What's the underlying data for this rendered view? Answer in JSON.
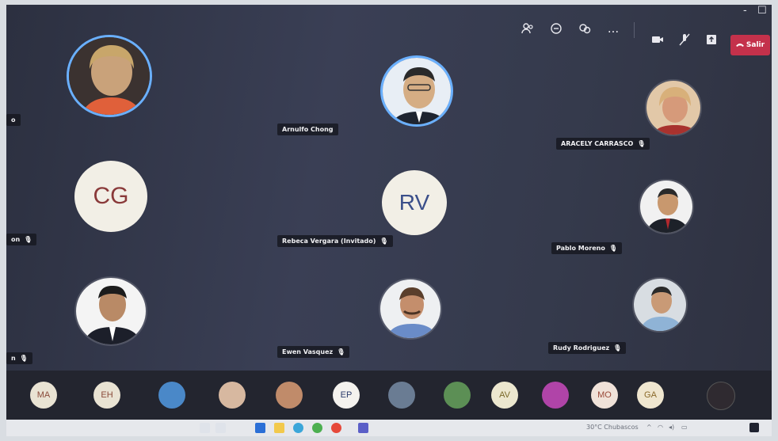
{
  "toolbar": {
    "participants_icon": "people-icon",
    "chat_icon": "chat-icon",
    "reactions_icon": "reactions-icon",
    "more_label": "...",
    "camera_icon": "camera-icon",
    "mic_icon": "mic-off-icon",
    "share_icon": "share-icon",
    "leave_label": "Salir",
    "window_minimize": "-",
    "window_maximize": "☐"
  },
  "tiles": [
    {
      "name": "o",
      "type": "photo",
      "highlight": true
    },
    {
      "name": "Arnulfo Chong",
      "type": "photo",
      "highlight": true
    },
    {
      "name": "ARACELY CARRASCO",
      "type": "photo",
      "muted": true
    },
    {
      "name": "on",
      "type": "initials",
      "initials": "CG",
      "muted": true
    },
    {
      "name": "Rebeca Vergara (Invitado)",
      "type": "initials",
      "initials": "RV",
      "muted": true
    },
    {
      "name": "Pablo Moreno",
      "type": "photo",
      "muted": true
    },
    {
      "name": "n",
      "type": "photo",
      "muted": true
    },
    {
      "name": "Ewen Vasquez",
      "type": "photo",
      "muted": true
    },
    {
      "name": "Rudy Rodriguez",
      "type": "photo",
      "muted": true
    }
  ],
  "strip": [
    {
      "kind": "initials",
      "text": "MA"
    },
    {
      "kind": "initials",
      "text": "EH"
    },
    {
      "kind": "photo"
    },
    {
      "kind": "photo"
    },
    {
      "kind": "photo"
    },
    {
      "kind": "initials",
      "text": "EP"
    },
    {
      "kind": "photo"
    },
    {
      "kind": "photo"
    },
    {
      "kind": "initials",
      "text": "AV"
    },
    {
      "kind": "photo"
    },
    {
      "kind": "initials",
      "text": "MO"
    },
    {
      "kind": "initials",
      "text": "GA"
    },
    {
      "kind": "photo"
    }
  ],
  "taskbar": {
    "weather": "30°C Chubascos",
    "tray_icons": [
      "chevron-up-icon",
      "wifi-icon",
      "volume-icon",
      "battery-icon"
    ],
    "clock_time": "",
    "clock_date": ""
  },
  "colors": {
    "accent_ring": "#6ab0ff",
    "leave_red": "#c4314b",
    "initials_bg": "#f2efe6"
  }
}
